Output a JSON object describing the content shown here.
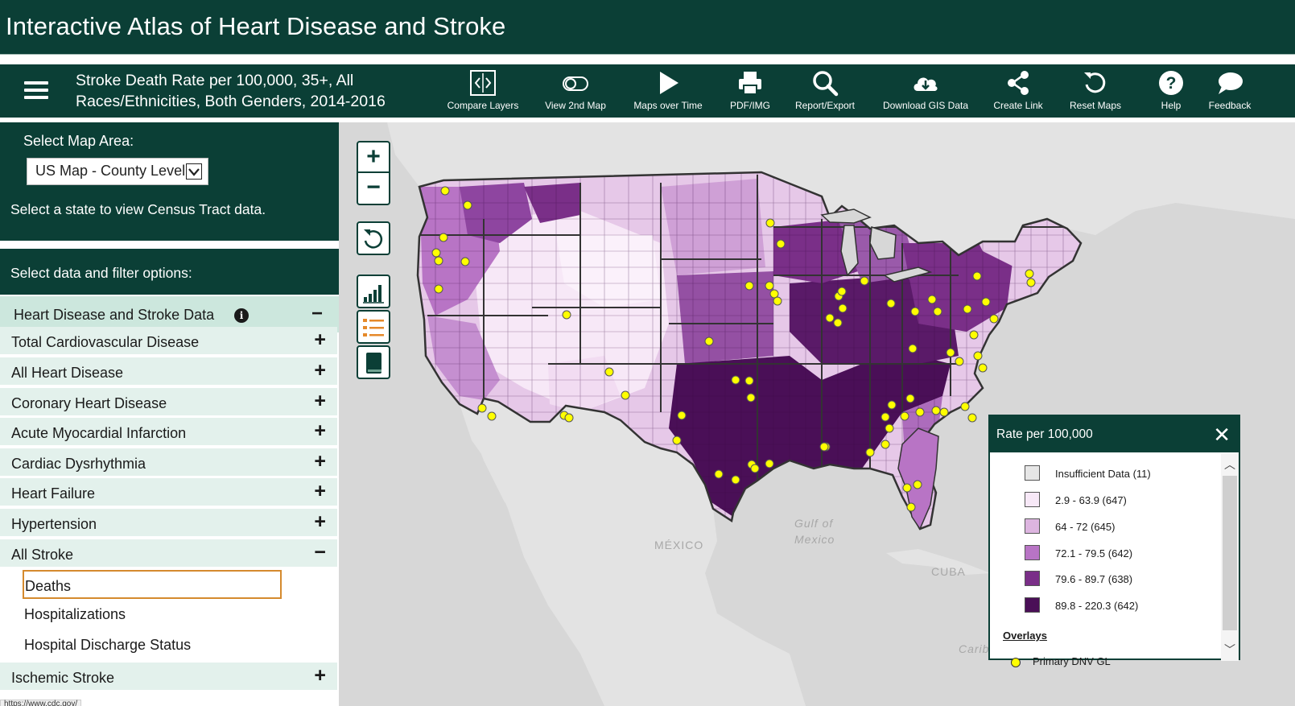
{
  "app": {
    "title": "Interactive Atlas of Heart Disease and Stroke"
  },
  "toolbar": {
    "map_heading": "Stroke Death Rate per 100,000, 35+, All Races/Ethnicities, Both Genders, 2014-2016",
    "tools": [
      {
        "label": "Compare Layers",
        "icon": "compare-layers-icon"
      },
      {
        "label": "View 2nd Map",
        "icon": "toggle-icon"
      },
      {
        "label": "Maps over Time",
        "icon": "play-icon"
      },
      {
        "label": "PDF/IMG",
        "icon": "printer-icon"
      },
      {
        "label": "Report/Export",
        "icon": "search-icon"
      },
      {
        "label": "Download GIS Data",
        "icon": "cloud-download-icon"
      },
      {
        "label": "Create Link",
        "icon": "share-icon"
      },
      {
        "label": "Reset Maps",
        "icon": "reset-icon"
      },
      {
        "label": "Help",
        "icon": "help-icon"
      },
      {
        "label": "Feedback",
        "icon": "chat-bubble-icon"
      }
    ]
  },
  "map_area": {
    "label": "Select Map Area:",
    "selected": "US Map - County Level",
    "hint": "Select a state to view Census Tract data."
  },
  "filters": {
    "header": "Select data and filter options:",
    "group_title": "Heart Disease and Stroke Data",
    "group_expanded_sign": "−",
    "items": [
      {
        "label": "Total Cardiovascular Disease",
        "sign": "+"
      },
      {
        "label": "All Heart Disease",
        "sign": "+"
      },
      {
        "label": "Coronary Heart Disease",
        "sign": "+"
      },
      {
        "label": "Acute Myocardial Infarction",
        "sign": "+"
      },
      {
        "label": "Cardiac Dysrhythmia",
        "sign": "+"
      },
      {
        "label": "Heart Failure",
        "sign": "+"
      },
      {
        "label": "Hypertension",
        "sign": "+"
      },
      {
        "label": "All Stroke",
        "sign": "−"
      }
    ],
    "stroke_subitems": [
      {
        "label": "Deaths",
        "selected": true
      },
      {
        "label": "Hospitalizations",
        "selected": false
      },
      {
        "label": "Hospital Discharge Status",
        "selected": false
      }
    ],
    "next_item": {
      "label": "Ischemic Stroke",
      "sign": "+"
    }
  },
  "map": {
    "zoom_in": "+",
    "zoom_out": "−",
    "geo_labels": {
      "gulf": "Gulf of Mexico",
      "mexico": "MÉXICO",
      "cuba": "CUBA",
      "carib": "Carib"
    }
  },
  "legend": {
    "title": "Rate per 100,000",
    "close": "✕",
    "items": [
      {
        "label": "Insufficient Data (11)",
        "color": "#e6e6e6"
      },
      {
        "label": "2.9 - 63.9 (647)",
        "color": "#f7e8f7"
      },
      {
        "label": "64 - 72 (645)",
        "color": "#ddb5e0"
      },
      {
        "label": "72.1 - 79.5 (642)",
        "color": "#b874c5"
      },
      {
        "label": "79.6 - 89.7 (638)",
        "color": "#7a2f88"
      },
      {
        "label": "89.8 - 220.3 (642)",
        "color": "#4a0f57"
      }
    ],
    "overlays_title": "Overlays",
    "overlay_item": "Primary DNV GL"
  },
  "status_bar": {
    "url": "https://www.cdc.gov/"
  }
}
